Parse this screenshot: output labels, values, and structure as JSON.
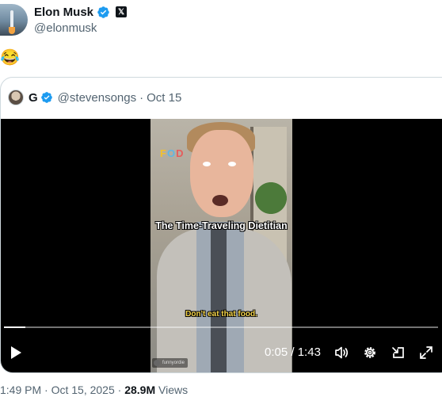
{
  "tweet": {
    "author": {
      "name": "Elon Musk",
      "handle": "@elonmusk",
      "affiliate_badge": "𝕏"
    },
    "text": "😂",
    "timestamp": "1:49 PM",
    "date": "Oct 15, 2025",
    "separator": "·",
    "views_count": "28.9M",
    "views_label": "Views"
  },
  "quote": {
    "author": {
      "name": "G",
      "handle": "@stevensongs"
    },
    "separator": "·",
    "date": "Oct 15",
    "video": {
      "overlay_logo": [
        "F",
        "O",
        "D"
      ],
      "caption_title": "The Time-Traveling Dietitian",
      "caption_subtitle": "Don't eat that food.",
      "watermark": "funnyordie",
      "current_time": "0:05",
      "duration": "1:43",
      "time_separator": " / ",
      "progress": 0.05
    }
  },
  "colors": {
    "verified_blue": "#1d9bf0",
    "secondary_text": "#535471",
    "border": "#cfd9de"
  },
  "icons": [
    "verified-badge-icon",
    "play-icon",
    "volume-icon",
    "settings-gear-icon",
    "picture-in-picture-icon",
    "fullscreen-icon"
  ]
}
